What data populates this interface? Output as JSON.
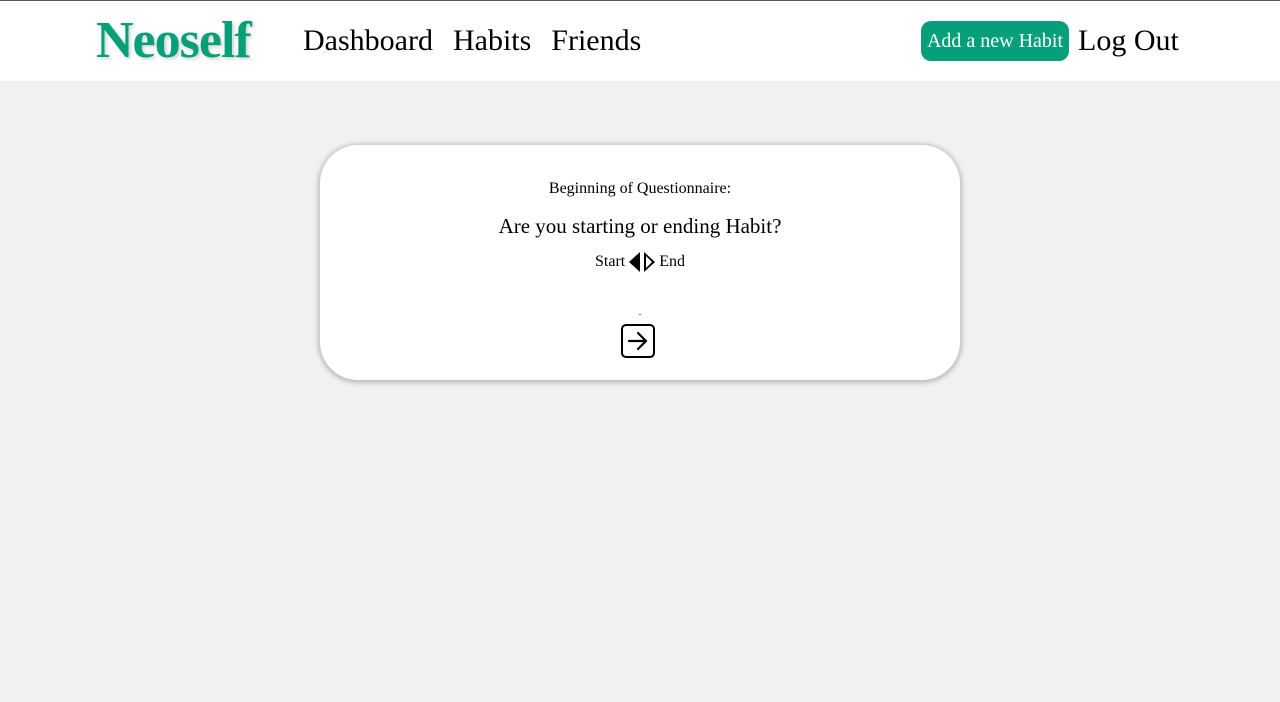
{
  "nav": {
    "logo": "Neoself",
    "links": [
      "Dashboard",
      "Habits",
      "Friends"
    ],
    "add_habit_label": "Add a new Habit",
    "logout_label": "Log Out"
  },
  "questionnaire": {
    "heading": "Beginning of Questionnaire:",
    "question": "Are you starting or ending Habit?",
    "option_start": "Start",
    "option_end": "End",
    "next_icon": "arrow-right-square-icon"
  },
  "colors": {
    "brand": "#059f7a",
    "background": "#f1f1f1",
    "card": "#ffffff"
  }
}
